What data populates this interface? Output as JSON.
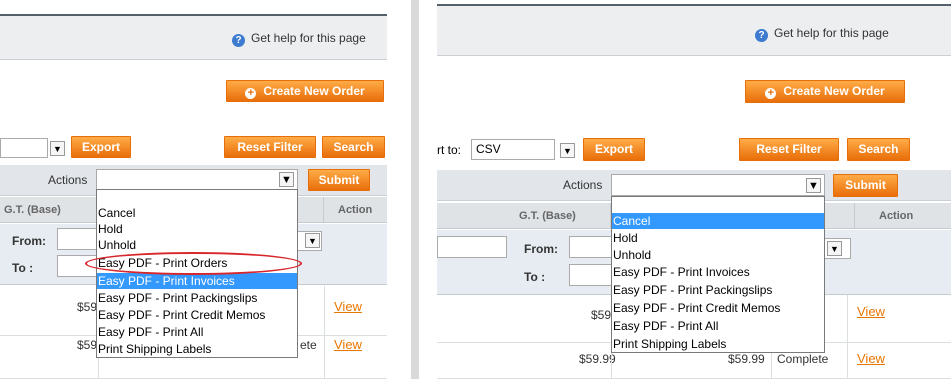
{
  "header": {
    "help_link": "Get help for this page"
  },
  "buttons": {
    "create_new_order": "Create New Order",
    "export": "Export",
    "reset_filter": "Reset Filter",
    "search": "Search",
    "submit": "Submit"
  },
  "export_row": {
    "label_partial": "rt to:",
    "format_value": "CSV"
  },
  "mass_actions": {
    "label": "Actions"
  },
  "grid": {
    "columns": [
      "G.T. (Base)",
      "Action"
    ],
    "filter": {
      "from_label": "From:",
      "to_label": "To :"
    },
    "rows": [
      {
        "gt_base_left": "$59",
        "gt_base_right": "$59",
        "action": "View"
      },
      {
        "gt_base_left": "$59",
        "gt_base_right": "$59.99",
        "gt_base_right_2": "$59.99",
        "status_right": "Complete",
        "status_left": "ete",
        "action": "View"
      }
    ]
  },
  "left_panel": {
    "options": [
      "Cancel",
      "Hold",
      "Unhold",
      "Easy PDF - Print Orders",
      "Easy PDF - Print Invoices",
      "Easy PDF - Print Packingslips",
      "Easy PDF - Print Credit Memos",
      "Easy PDF - Print All",
      "Print Shipping Labels"
    ],
    "selected_option": "Easy PDF - Print Invoices",
    "circled_option": "Easy PDF - Print Orders"
  },
  "right_panel": {
    "options": [
      "Cancel",
      "Hold",
      "Unhold",
      "Easy PDF - Print Invoices",
      "Easy PDF - Print Packingslips",
      "Easy PDF - Print Credit Memos",
      "Easy PDF - Print All",
      "Print Shipping Labels"
    ],
    "selected_option": "Cancel"
  },
  "colors": {
    "accent_orange": "#e86e0a",
    "selection_blue": "#3399ff",
    "circle_red": "#d8262a",
    "help_icon": "#3c7bd0"
  },
  "icons": {
    "help": "help-circle-icon",
    "create": "plus-circle-icon",
    "dropdown": "chevron-down-icon"
  }
}
